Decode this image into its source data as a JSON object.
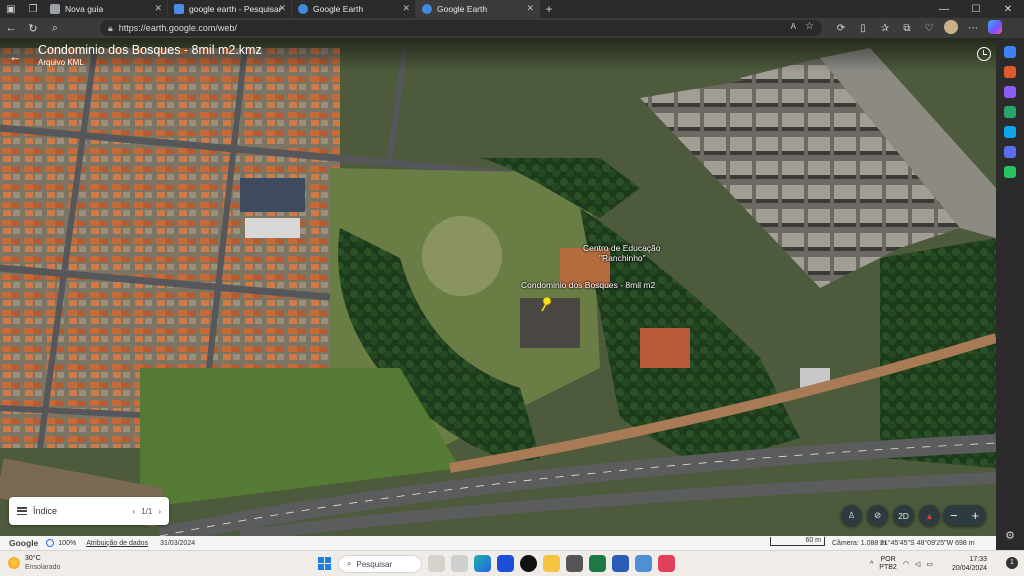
{
  "tabs": [
    {
      "title": "Nova guia",
      "color": "#9aa0a6",
      "active": false
    },
    {
      "title": "google earth - Pesquisar",
      "color": "#4a8ce8",
      "active": false
    },
    {
      "title": "Google Earth",
      "color": "#3e8be0",
      "active": false
    },
    {
      "title": "Google Earth",
      "color": "#3e8be0",
      "active": true
    }
  ],
  "address": {
    "url": "https://earth.google.com/web/"
  },
  "document": {
    "title": "Condominio dos Bosques - 8mil m2.kmz",
    "subtitle": "Arquivo KML"
  },
  "map_labels": {
    "school_line1": "Centro de Educação",
    "school_line2": "\"Ranchinho\"",
    "placemark": "Condominio dos Bosques - 8mil m2"
  },
  "index_panel": {
    "label": "Índice",
    "page": "1/1"
  },
  "controls": {
    "view_mode": "2D"
  },
  "status": {
    "brand": "Google",
    "load_percent": "100%",
    "attribution": "Atribuição de dados",
    "date": "31/03/2024",
    "scale": "60 m",
    "camera": "Câmera: 1.088 m",
    "coords": "21°45'45\"S 48°09'25\"W  698 m"
  },
  "taskbar": {
    "temp": "30°C",
    "weather": "Ensolarado",
    "search_placeholder": "Pesquisar",
    "lang1": "POR",
    "lang2": "PTB2",
    "time": "17:33",
    "date": "20/04/2024",
    "notifications": "1"
  },
  "sidebar_colors": [
    "#3b82f6",
    "#e05a2b",
    "#8b5cf6",
    "#2aa36b",
    "#0ea5e9",
    "#5b6cf0",
    "#22c55e"
  ]
}
